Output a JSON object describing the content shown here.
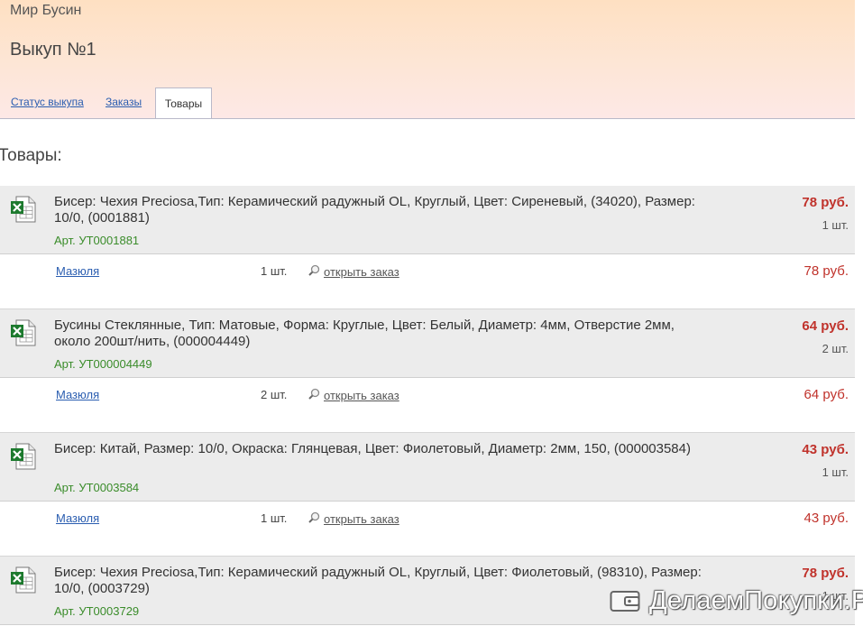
{
  "header": {
    "site_name": "Мир Бусин",
    "page_title": "Выкуп №1",
    "tabs": [
      {
        "label": "Статус выкупа"
      },
      {
        "label": "Заказы"
      },
      {
        "label": "Товары"
      }
    ]
  },
  "section_title": "Товары:",
  "open_order_label": "открыть заказ",
  "icons": {
    "item": "excel-file-icon",
    "open": "magnifier-icon",
    "watermark": "wallet-icon"
  },
  "colors": {
    "price": "#c0322b",
    "article": "#3a8c2a",
    "link": "#2a5db0"
  },
  "items": [
    {
      "title": "Бисер: Чехия Preciosa,Тип: Керамический радужный OL, Круглый, Цвет: Сиреневый, (34020), Размер: 10/0, (0001881)",
      "article": "Арт. УТ0001881",
      "price": "78 руб.",
      "qty": "1 шт.",
      "buyer": "Мазюля",
      "order_qty": "1 шт.",
      "order_price": "78 руб."
    },
    {
      "title": "Бусины Стеклянные, Тип: Матовые, Форма: Круглые, Цвет: Белый, Диаметр: 4мм, Отверстие 2мм, около 200шт/нить, (000004449)",
      "article": "Арт. УТ000004449",
      "price": "64 руб.",
      "qty": "2 шт.",
      "buyer": "Мазюля",
      "order_qty": "2 шт.",
      "order_price": "64 руб."
    },
    {
      "title": "Бисер: Китай, Размер: 10/0, Окраска: Глянцевая, Цвет: Фиолетовый, Диаметр: 2мм, 150, (000003584)",
      "article": "Арт. УТ0003584",
      "price": "43 руб.",
      "qty": "1 шт.",
      "buyer": "Мазюля",
      "order_qty": "1 шт.",
      "order_price": "43 руб."
    },
    {
      "title": "Бисер: Чехия Preciosa,Тип: Керамический радужный OL, Круглый, Цвет: Фиолетовый, (98310), Размер: 10/0, (0003729)",
      "article": "Арт. УТ0003729",
      "price": "78 руб.",
      "qty": "1 шт."
    }
  ],
  "watermark": "ДелаемПокупки.Ру"
}
